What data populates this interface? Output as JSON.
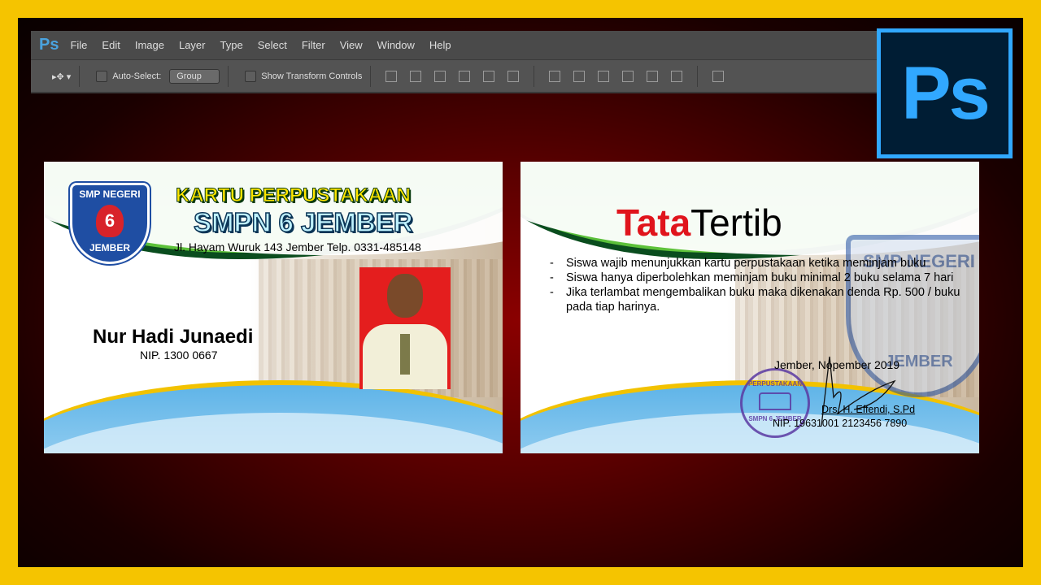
{
  "photoshop": {
    "menu": [
      "File",
      "Edit",
      "Image",
      "Layer",
      "Type",
      "Select",
      "Filter",
      "View",
      "Window",
      "Help"
    ],
    "logo": "Ps",
    "options": {
      "auto_select_label": "Auto-Select:",
      "auto_select_value": "Group",
      "show_transform_label": "Show Transform Controls"
    }
  },
  "ps_badge": "Ps",
  "front_card": {
    "logo_top": "SMP NEGERI",
    "logo_number": "6",
    "logo_bottom": "JEMBER",
    "title": "KARTU PERPUSTAKAAN",
    "school": "SMPN 6 JEMBER",
    "address": "Jl. Hayam Wuruk 143 Jember Telp. 0331-485148",
    "name": "Nur Hadi Junaedi",
    "nip": "NIP. 1300 0667"
  },
  "back_card": {
    "title_red": "Tata",
    "title_black": "Tertib",
    "rules": [
      "Siswa wajib menunjukkan kartu perpustakaan ketika meminjam buku",
      "Siswa hanya diperbolehkan meminjam buku minimal 2 buku selama 7 hari",
      "Jika terlambat mengembalikan buku maka dikenakan denda Rp. 500 / buku pada tiap harinya."
    ],
    "watermark_top": "SMP NEGERI",
    "watermark_bottom": "JEMBER",
    "date": "Jember,  Nopember 2019",
    "signer": "Drs. H. Effendi, S.Pd",
    "signer_nip": "NIP. 19631001 2123456 7890",
    "stamp_top": "PERPUSTAKAAN",
    "stamp_bottom": "SMPN 6 JEMBER"
  }
}
